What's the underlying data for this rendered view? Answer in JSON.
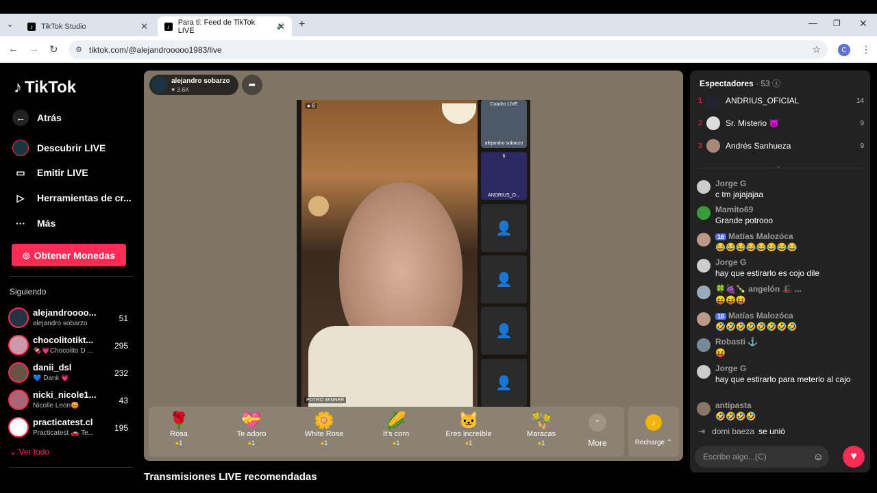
{
  "browser": {
    "tabs": [
      {
        "label": "TikTok Studio",
        "active": false
      },
      {
        "label": "Para ti: Feed de TikTok LIVE",
        "active": true
      }
    ],
    "url": "tiktok.com/@alejandrooooo1983/live",
    "profile_initial": "C"
  },
  "sidebar": {
    "logo": "TikTok",
    "nav": [
      {
        "label": "Atrás",
        "icon": "back-arrow-icon"
      },
      {
        "label": "Descubrir LIVE",
        "icon": "live-avatar-icon"
      },
      {
        "label": "Emitir LIVE",
        "icon": "camera-icon"
      },
      {
        "label": "Herramientas de cr...",
        "icon": "play-circle-icon"
      },
      {
        "label": "Más",
        "icon": "more-dots-icon"
      }
    ],
    "coins_button": "Obtener Monedas",
    "following_label": "Siguiendo",
    "following": [
      {
        "name": "alejandroooo...",
        "sub": "alejandro sobarzo",
        "count": "51"
      },
      {
        "name": "chocolitotikt...",
        "sub": "🍫💗Chocolito D ...",
        "count": "295"
      },
      {
        "name": "danii_dsl",
        "sub": "💙 Danii 💗",
        "count": "232"
      },
      {
        "name": "nicki_nicole1...",
        "sub": "Nicolle Leon😡",
        "count": "43"
      },
      {
        "name": "practicatest.cl",
        "sub": "Practicatest 🚗 Te...",
        "count": "195"
      }
    ],
    "see_all": "Ver todo"
  },
  "stream": {
    "host_name": "alejandro sobarzo",
    "host_likes": "♥ 3.6K",
    "top_count": "6",
    "watermark": "POTRO WINNER",
    "side_slot_1": "Cuadro LIVE",
    "side_slot_1_sub": "alejandro sobarzo",
    "side_slot_2_count": "6",
    "side_slot_2": "ANDRIUS_O..."
  },
  "gifts": [
    {
      "name": "Rosa",
      "emoji": "🌹",
      "cost": "1"
    },
    {
      "name": "Te adoro",
      "emoji": "💝",
      "cost": "1"
    },
    {
      "name": "White Rose",
      "emoji": "🌼",
      "cost": "1"
    },
    {
      "name": "It's corn",
      "emoji": "🌽",
      "cost": "1"
    },
    {
      "name": "Eres increíble",
      "emoji": "🐱",
      "cost": "1"
    },
    {
      "name": "Maracas",
      "emoji": "🪇",
      "cost": "1"
    }
  ],
  "gift_more": "More",
  "recharge": "Recharge",
  "recommended_title": "Transmisiones LIVE recomendadas",
  "chat": {
    "viewers_label": "Espectadores",
    "viewers_count": "· 53",
    "viewers": [
      {
        "rank": "1",
        "name": "ANDRIUS_OFICIAL",
        "count": "14"
      },
      {
        "rank": "2",
        "name": "Sr. Misterio 👿",
        "count": "9"
      },
      {
        "rank": "3",
        "name": "Andrés Sanhueza",
        "count": "9"
      }
    ],
    "messages": [
      {
        "name": "Jorge G",
        "text": "c tm jajajajaa"
      },
      {
        "name": "Mamito69",
        "text": "Grande potrooo"
      },
      {
        "name": "Matías Malozóca",
        "badge": "16",
        "text": "😂😂😂😂😂😂😂😂"
      },
      {
        "name": "Jorge G",
        "text": "hay que estirarlo es cojo dile"
      },
      {
        "name": "🍀🍇🍾 angelón 🎩 ...",
        "text": "😝😝😝"
      },
      {
        "name": "Matías Malozóca",
        "badge": "16",
        "text": "🤣🤣🤣🤣🤣🤣🤣🤣"
      },
      {
        "name": "Robasti ⚓",
        "text": "😝"
      },
      {
        "name": "Jorge G",
        "text": "hay que estirarlo para meterlo al cajo"
      },
      {
        "name": "antipasta",
        "text": "🤣🤣🤣🤣"
      }
    ],
    "join_name": "domi baeza",
    "join_text": "se unió",
    "input_placeholder": "Escribe algo...(C)"
  }
}
